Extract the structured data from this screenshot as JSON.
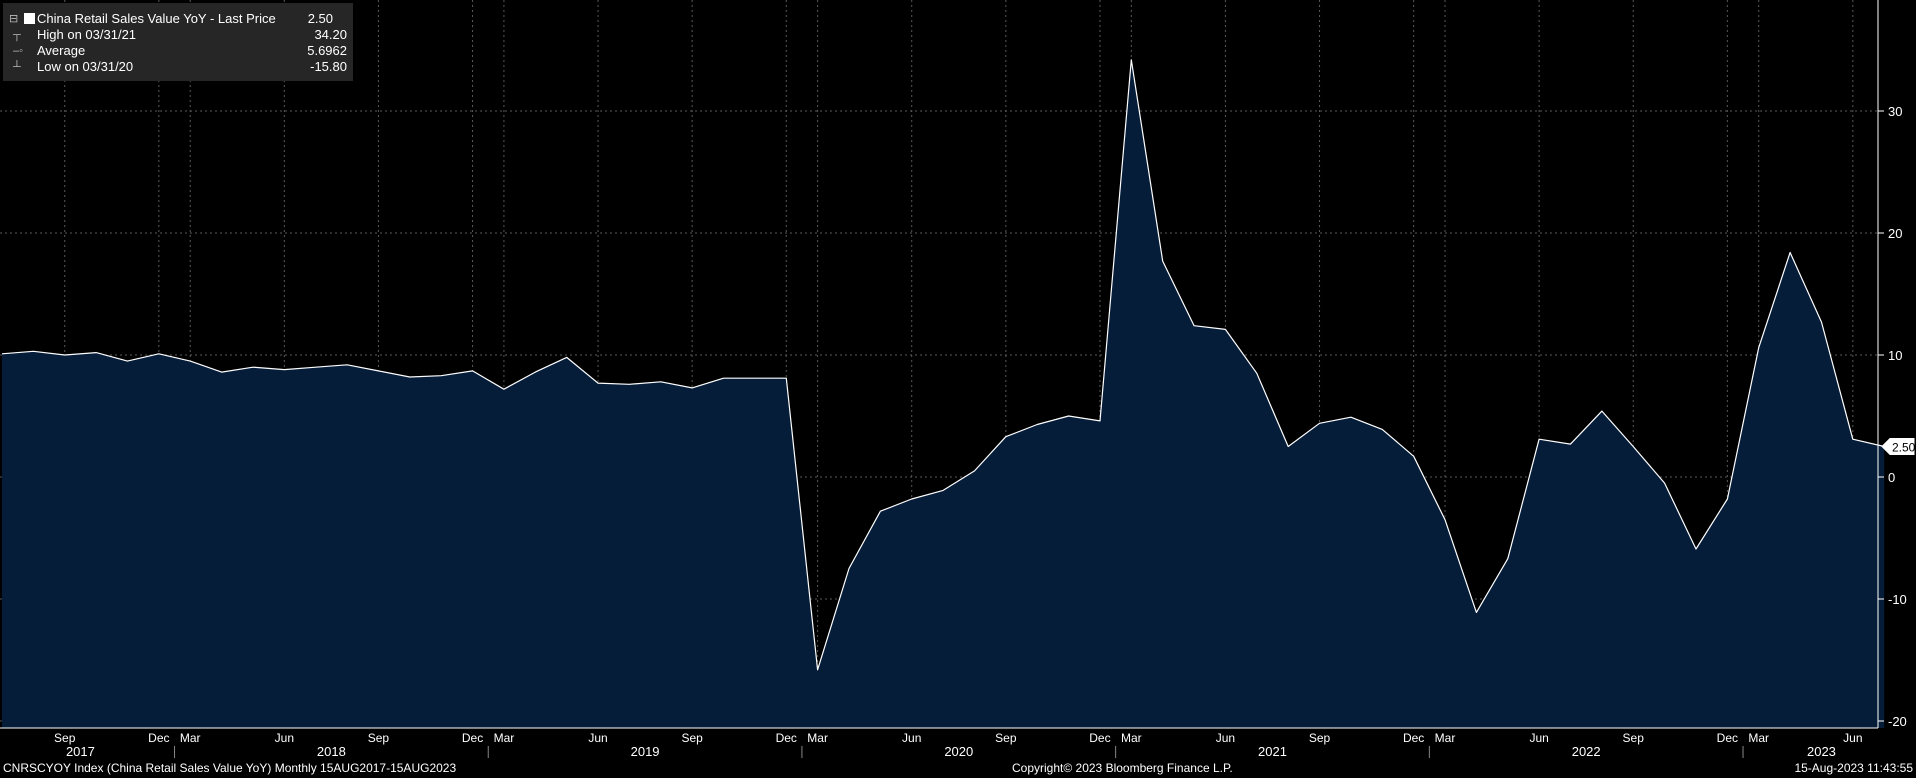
{
  "legend": {
    "series_label": "China Retail Sales Value YoY - Last Price",
    "series_value": "2.50",
    "high_label": "High on 03/31/21",
    "high_value": "34.20",
    "avg_label": "Average",
    "avg_value": "5.6962",
    "low_label": "Low on 03/31/20",
    "low_value": "-15.80"
  },
  "footer": {
    "left": "CNRSCYOY Index (China Retail Sales Value YoY)  Monthly 15AUG2017-15AUG2023",
    "center": "Copyright© 2023 Bloomberg Finance L.P.",
    "right": "15-Aug-2023 11:43:55"
  },
  "colors": {
    "background": "#000000",
    "area_fill": "#061d3a",
    "line": "#ffffff",
    "grid": "#5a5a5a",
    "legend_bg": "#262626"
  },
  "chart_data": {
    "type": "area",
    "series": [
      {
        "name": "China Retail Sales Value YoY",
        "x": [
          "2017-07",
          "2017-08",
          "2017-09",
          "2017-10",
          "2017-11",
          "2017-12",
          "2018-03",
          "2018-04",
          "2018-05",
          "2018-06",
          "2018-07",
          "2018-08",
          "2018-09",
          "2018-10",
          "2018-11",
          "2018-12",
          "2019-03",
          "2019-04",
          "2019-05",
          "2019-06",
          "2019-07",
          "2019-08",
          "2019-09",
          "2019-10",
          "2019-11",
          "2019-12",
          "2020-03",
          "2020-04",
          "2020-05",
          "2020-06",
          "2020-07",
          "2020-08",
          "2020-09",
          "2020-10",
          "2020-11",
          "2020-12",
          "2021-03",
          "2021-04",
          "2021-05",
          "2021-06",
          "2021-07",
          "2021-08",
          "2021-09",
          "2021-10",
          "2021-11",
          "2021-12",
          "2022-03",
          "2022-04",
          "2022-05",
          "2022-06",
          "2022-07",
          "2022-08",
          "2022-09",
          "2022-10",
          "2022-11",
          "2022-12",
          "2023-03",
          "2023-04",
          "2023-05",
          "2023-06",
          "2023-07"
        ],
        "values": [
          10.1,
          10.3,
          10.0,
          10.2,
          9.5,
          10.1,
          9.5,
          8.6,
          9.0,
          8.8,
          9.0,
          9.2,
          8.7,
          8.2,
          8.3,
          8.7,
          7.2,
          8.6,
          9.8,
          7.7,
          7.6,
          7.8,
          7.3,
          8.1,
          8.1,
          8.1,
          -15.8,
          -7.5,
          -2.8,
          -1.8,
          -1.1,
          0.5,
          3.3,
          4.3,
          5.0,
          4.6,
          34.2,
          17.7,
          12.4,
          12.1,
          8.5,
          2.5,
          4.4,
          4.9,
          3.9,
          1.7,
          -3.5,
          -11.1,
          -6.7,
          3.1,
          2.7,
          5.4,
          2.5,
          -0.5,
          -5.9,
          -1.8,
          10.6,
          18.4,
          12.7,
          3.1,
          2.5
        ]
      }
    ],
    "summary": {
      "last": 2.5,
      "high": 34.2,
      "high_date": "03/31/21",
      "average": 5.6962,
      "low": -15.8,
      "low_date": "03/31/20"
    },
    "last_value_label": "2.50",
    "ylim": [
      -20,
      35
    ],
    "y_ticks": [
      -20,
      -10,
      0,
      10,
      20,
      30
    ],
    "y_axis_position": "right",
    "month_ticks": [
      {
        "date": "2017-09",
        "label": "Sep"
      },
      {
        "date": "2017-12",
        "label": "Dec"
      },
      {
        "date": "2018-03",
        "label": "Mar"
      },
      {
        "date": "2018-06",
        "label": "Jun"
      },
      {
        "date": "2018-09",
        "label": "Sep"
      },
      {
        "date": "2018-12",
        "label": "Dec"
      },
      {
        "date": "2019-03",
        "label": "Mar"
      },
      {
        "date": "2019-06",
        "label": "Jun"
      },
      {
        "date": "2019-09",
        "label": "Sep"
      },
      {
        "date": "2019-12",
        "label": "Dec"
      },
      {
        "date": "2020-03",
        "label": "Mar"
      },
      {
        "date": "2020-06",
        "label": "Jun"
      },
      {
        "date": "2020-09",
        "label": "Sep"
      },
      {
        "date": "2020-12",
        "label": "Dec"
      },
      {
        "date": "2021-03",
        "label": "Mar"
      },
      {
        "date": "2021-06",
        "label": "Jun"
      },
      {
        "date": "2021-09",
        "label": "Sep"
      },
      {
        "date": "2021-12",
        "label": "Dec"
      },
      {
        "date": "2022-03",
        "label": "Mar"
      },
      {
        "date": "2022-06",
        "label": "Jun"
      },
      {
        "date": "2022-09",
        "label": "Sep"
      },
      {
        "date": "2022-12",
        "label": "Dec"
      },
      {
        "date": "2023-03",
        "label": "Mar"
      },
      {
        "date": "2023-06",
        "label": "Jun"
      }
    ],
    "year_labels": [
      "2017",
      "2018",
      "2019",
      "2020",
      "2021",
      "2022",
      "2023"
    ],
    "grid": true,
    "legend_position": "top-left"
  }
}
